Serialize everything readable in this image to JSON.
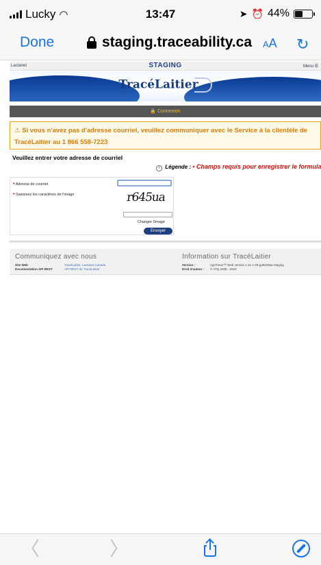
{
  "status": {
    "carrier": "Lucky",
    "time": "13:47",
    "battery": "44%",
    "battery_level": 0.44
  },
  "browser": {
    "done_label": "Done",
    "url": "staging.traceability.ca",
    "text_size_label_small": "A",
    "text_size_label_large": "A"
  },
  "site": {
    "top_left": "Lactanet",
    "env_label": "STAGING",
    "menu_label": "Menu ☰",
    "logo_text": "TracéLaitier",
    "connection_label": "🔒 Connexion",
    "warning_line1": "⚠ Si vous n'avez pas d'adresse courriel, veuillez communiquer avec le Service à la clientèle de",
    "warning_line2": "TracéLaitier au 1 866 558-7223",
    "email_heading": "Veuillez entrer votre adresse de courriel",
    "legend_prefix": "Légende :",
    "legend_required": "• Champs requis pour enregistrer le formulaire",
    "form": {
      "email_label": "Adresse de courriel",
      "captcha_label": "Saisissez les caractères de l'image",
      "captcha_text": "r645ua",
      "change_image": "Changer l'image",
      "send_label": "Envoyer"
    },
    "footer": {
      "contact_title": "Communiquez avec nous",
      "website_label": "Site Web",
      "website_links": "TracéLaitier, Lactanet Canada",
      "api_label": "Documentation API REST",
      "api_link": "API REST de TracéLaitier",
      "info_title": "Information sur TracéLaitier",
      "version_label": "Version :",
      "version_value": "AgriTrace™ Web version 1.31.1-29-ga9226ae-staging",
      "copyright_label": "Droit d'auteur :",
      "copyright_value": "© ATQ 2008 - 2023"
    }
  },
  "toolbar": {
    "back_label": "〈",
    "forward_label": "〉"
  }
}
